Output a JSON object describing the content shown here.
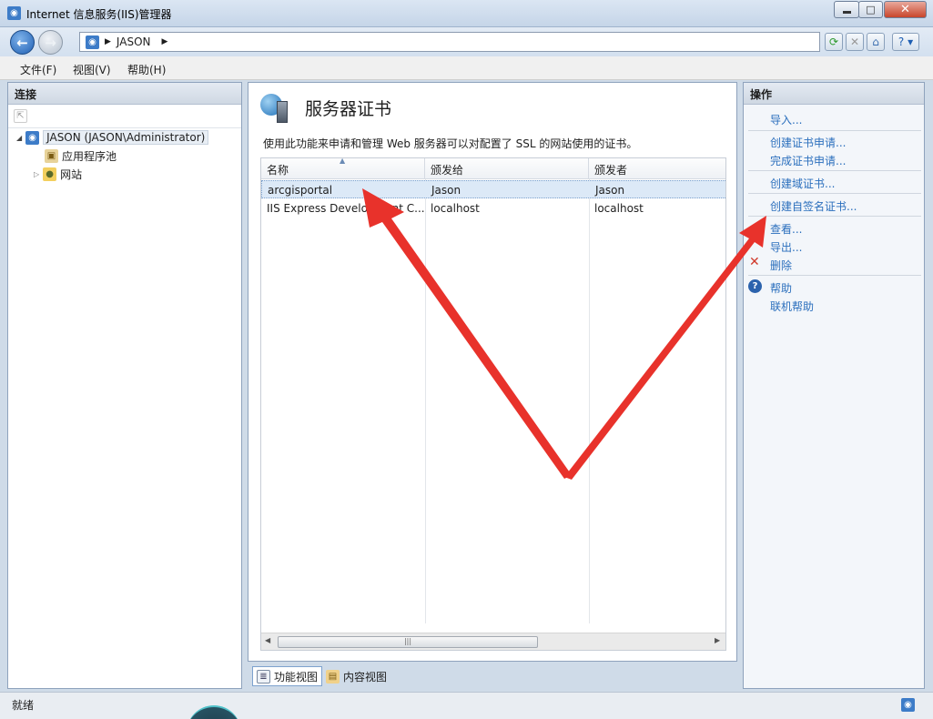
{
  "window": {
    "title": "Internet 信息服务(IIS)管理器",
    "minimize": "▭",
    "maximize": "□",
    "close": "✕"
  },
  "address": {
    "crumb": "JASON"
  },
  "menu": {
    "file": "文件(F)",
    "view": "视图(V)",
    "help": "帮助(H)"
  },
  "connections": {
    "header": "连接",
    "server": "JASON (JASON\\Administrator)",
    "app_pools": "应用程序池",
    "sites": "网站"
  },
  "feature": {
    "title": "服务器证书",
    "description": "使用此功能来申请和管理 Web 服务器可以对配置了 SSL 的网站使用的证书。",
    "columns": [
      "名称",
      "颁发给",
      "颁发者"
    ],
    "rows": [
      {
        "name": "arcgisportal",
        "issued_to": "Jason",
        "issued_by": "Jason"
      },
      {
        "name": "IIS Express Development C...",
        "issued_to": "localhost",
        "issued_by": "localhost"
      }
    ]
  },
  "tabs": {
    "features_view": "功能视图",
    "content_view": "内容视图"
  },
  "actions": {
    "header": "操作",
    "import": "导入...",
    "create_request": "创建证书申请...",
    "complete_request": "完成证书申请...",
    "create_domain": "创建域证书...",
    "create_self_signed": "创建自签名证书...",
    "view": "查看...",
    "export": "导出...",
    "delete": "删除",
    "help": "帮助",
    "online_help": "联机帮助"
  },
  "status": {
    "text": "就绪"
  },
  "colors": {
    "link": "#2b6fbd",
    "arrow": "#e8322b",
    "selection": "#dce9f7"
  }
}
